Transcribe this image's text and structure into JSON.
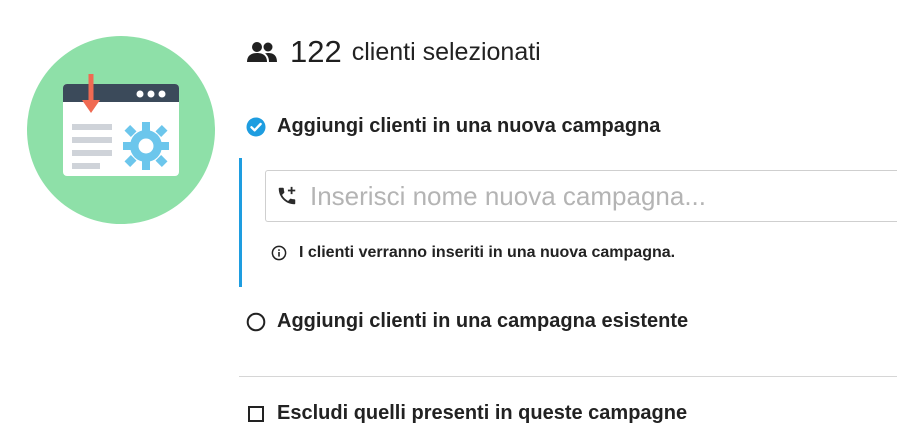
{
  "header": {
    "count": "122",
    "label": "clienti selezionati"
  },
  "options": {
    "new_campaign": {
      "label": "Aggiungi clienti in una nuova campagna",
      "checked": true
    },
    "existing_campaign": {
      "label": "Aggiungi clienti in una campagna esistente",
      "checked": false
    },
    "exclude": {
      "label": "Escludi quelli presenti in queste campagne",
      "checked": false
    }
  },
  "new_campaign_input": {
    "placeholder": "Inserisci nome nuova campagna...",
    "value": ""
  },
  "info": {
    "text": "I clienti verranno inseriti in una nuova campagna."
  },
  "icons": {
    "people": "people-icon",
    "checked_radio": "check-circle-icon",
    "radio": "radio-empty-icon",
    "checkbox": "checkbox-empty-icon",
    "phone_add": "phone-add-icon",
    "info": "info-icon",
    "illustration": "import-settings-illustration"
  },
  "colors": {
    "accent": "#1e9de0",
    "illustration_bg": "#8ee0a8"
  }
}
